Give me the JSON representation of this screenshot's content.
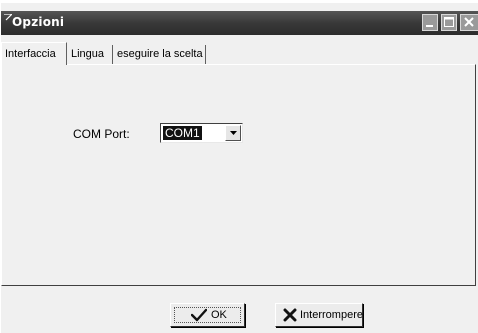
{
  "window": {
    "title": "Opzioni",
    "controls": [
      "minimize-icon",
      "maximize-icon",
      "close-icon"
    ],
    "title_bar_color": "#3a3a3a"
  },
  "tabs": [
    {
      "label": "Interfaccia",
      "active": true
    },
    {
      "label": "Lingua",
      "active": false
    },
    {
      "label": "eseguire la scelta",
      "active": false
    }
  ],
  "form": {
    "com_port_label": "COM Port:",
    "com_port_value": "COM1"
  },
  "buttons": {
    "ok_label": "OK",
    "ok_icon": "checkmark-icon",
    "cancel_label": "Interrompere",
    "cancel_icon": "x-icon"
  }
}
